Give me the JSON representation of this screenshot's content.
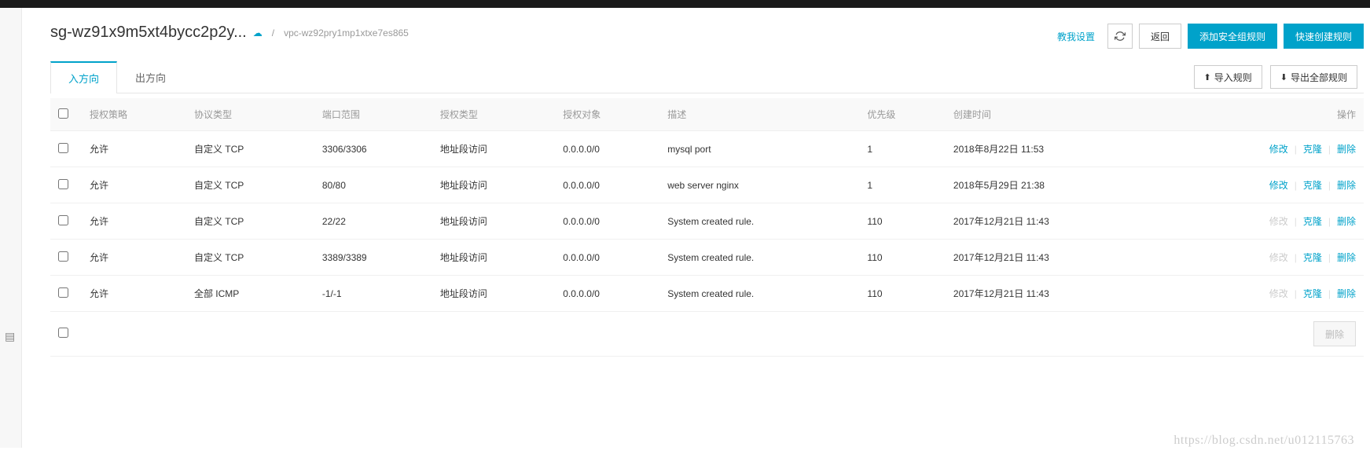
{
  "header": {
    "title": "sg-wz91x9m5xt4bycc2p2y...",
    "breadcrumb_sep": "/",
    "vpc_id": "vpc-wz92pry1mp1xtxe7es865",
    "tutorial_link": "教我设置",
    "back_button": "返回",
    "add_rule_button": "添加安全组规则",
    "quick_create_button": "快速创建规则"
  },
  "tabs": {
    "inbound": "入方向",
    "outbound": "出方向",
    "import_button": "导入规则",
    "export_button": "导出全部规则"
  },
  "table": {
    "columns": {
      "policy": "授权策略",
      "protocol": "协议类型",
      "port": "端口范围",
      "auth_type": "授权类型",
      "auth_object": "授权对象",
      "description": "描述",
      "priority": "优先级",
      "created": "创建时间",
      "actions": "操作"
    },
    "action_labels": {
      "modify": "修改",
      "clone": "克隆",
      "delete": "删除"
    },
    "rows": [
      {
        "policy": "允许",
        "protocol": "自定义 TCP",
        "port": "3306/3306",
        "auth_type": "地址段访问",
        "auth_object": "0.0.0.0/0",
        "description": "mysql port",
        "priority": "1",
        "created": "2018年8月22日 11:53",
        "modify_disabled": false
      },
      {
        "policy": "允许",
        "protocol": "自定义 TCP",
        "port": "80/80",
        "auth_type": "地址段访问",
        "auth_object": "0.0.0.0/0",
        "description": "web server nginx",
        "priority": "1",
        "created": "2018年5月29日 21:38",
        "modify_disabled": false
      },
      {
        "policy": "允许",
        "protocol": "自定义 TCP",
        "port": "22/22",
        "auth_type": "地址段访问",
        "auth_object": "0.0.0.0/0",
        "description": "System created rule.",
        "priority": "110",
        "created": "2017年12月21日 11:43",
        "modify_disabled": true
      },
      {
        "policy": "允许",
        "protocol": "自定义 TCP",
        "port": "3389/3389",
        "auth_type": "地址段访问",
        "auth_object": "0.0.0.0/0",
        "description": "System created rule.",
        "priority": "110",
        "created": "2017年12月21日 11:43",
        "modify_disabled": true
      },
      {
        "policy": "允许",
        "protocol": "全部 ICMP",
        "port": "-1/-1",
        "auth_type": "地址段访问",
        "auth_object": "0.0.0.0/0",
        "description": "System created rule.",
        "priority": "110",
        "created": "2017年12月21日 11:43",
        "modify_disabled": true
      }
    ],
    "bulk_delete": "删除"
  },
  "watermark": "https://blog.csdn.net/u012115763"
}
